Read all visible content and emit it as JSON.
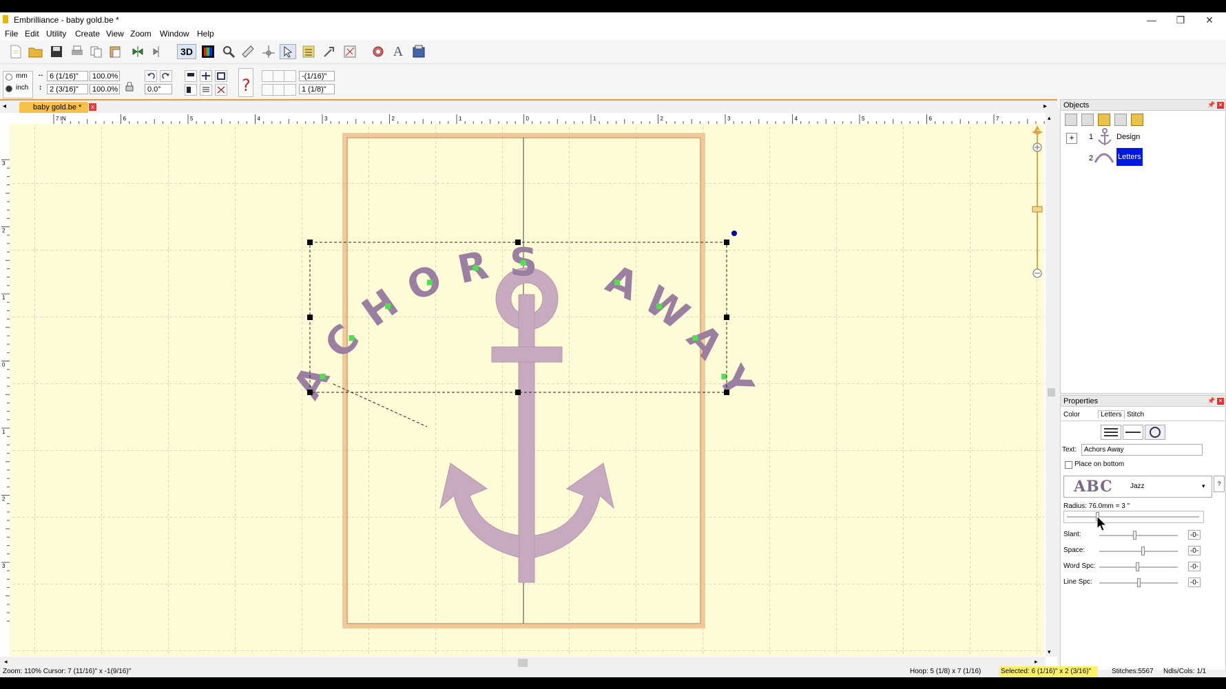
{
  "window": {
    "title": "Embrilliance - baby gold.be *"
  },
  "menu": [
    "File",
    "Edit",
    "Utility",
    "Create",
    "View",
    "Zoom",
    "Window",
    "Help"
  ],
  "toolbar": {
    "label_3d": "3D",
    "label_text": "A",
    "units": {
      "mm": "mm",
      "inch": "inch"
    },
    "width": "6 (1/16)\"",
    "height": "2 (3/16)\"",
    "scale_x": "100.0%",
    "scale_y": "100.0%",
    "rotation": "0.0°",
    "nudge_x": "-(1/16)\"",
    "nudge_y": "1 (1/8)\""
  },
  "document": {
    "tab": "baby gold.be *",
    "close": "x"
  },
  "ruler": {
    "h_labels": [
      "7 IN",
      "6",
      "5",
      "4",
      "3",
      "2",
      "1",
      "0",
      "1",
      "2",
      "3",
      "4",
      "5",
      "6",
      "7"
    ],
    "v_labels": [
      "3",
      "2",
      "1",
      "0",
      "1",
      "2",
      "3"
    ]
  },
  "design": {
    "text": "ACHORS AWAY",
    "letter_color": "#9b7fa0",
    "anchor_color": "#c7aabf",
    "hoop_color": "#f0c89a"
  },
  "objects_panel": {
    "title": "Objects",
    "items": [
      {
        "index": "1",
        "label": "Design"
      },
      {
        "index": "2",
        "label": "Letters"
      }
    ]
  },
  "properties_panel": {
    "title": "Properties",
    "tabs": [
      "Color",
      "Letters",
      "Stitch"
    ],
    "text_label": "Text:",
    "text_value": "Achors Away",
    "place_bottom_label": "Place on bottom",
    "font_sample": "ABC",
    "font_name": "Jazz",
    "help": "?",
    "radius_label": "Radius: 76.0mm = 3 \"",
    "sliders": [
      {
        "label": "Slant:",
        "value": "-0-",
        "level": 0.45
      },
      {
        "label": "Space:",
        "value": "-0-",
        "level": 0.55
      },
      {
        "label": "Word Spc:",
        "value": "-0-",
        "level": 0.48
      },
      {
        "label": "Line Spc:",
        "value": "-0-",
        "level": 0.5
      }
    ]
  },
  "status": {
    "zoom": "Zoom: 110%  Cursor: 7 (11/16)\" x -1(9/16)\"",
    "hoop": "Hoop: 5 (1/8) x 7 (1/16)",
    "selected": "Selected: 6 (1/16)\" x 2 (3/16)\"",
    "stitches": "Stitches:5567",
    "ndls": "Ndls/Cols: 1/1"
  }
}
